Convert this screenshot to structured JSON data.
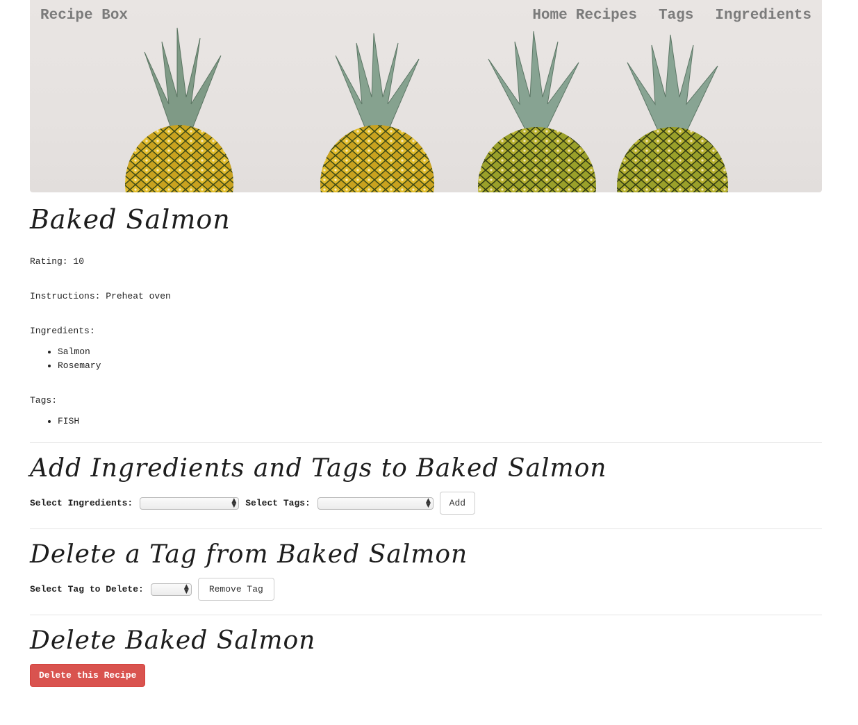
{
  "navbar": {
    "brand": "Recipe Box",
    "links": [
      "Home",
      "Recipes",
      "Tags",
      "Ingredients"
    ]
  },
  "recipe": {
    "title": "Baked Salmon",
    "rating_label": "Rating: 10",
    "instructions_label": "Instructions: Preheat oven",
    "ingredients_label": "Ingredients:",
    "ingredients": [
      "Salmon",
      "Rosemary"
    ],
    "tags_label": "Tags:",
    "tags": [
      "FISH"
    ]
  },
  "add_section": {
    "heading": "Add Ingredients and Tags to Baked Salmon",
    "ingredients_label": "Select Ingredients:",
    "tags_label": "Select Tags:",
    "button": "Add"
  },
  "delete_tag_section": {
    "heading": "Delete a Tag from Baked Salmon",
    "label": "Select Tag to Delete:",
    "button": "Remove Tag"
  },
  "delete_recipe_section": {
    "heading": "Delete Baked Salmon",
    "button": "Delete this Recipe"
  },
  "colors": {
    "danger": "#d9534f",
    "nav_text": "#7b7b7b",
    "hero_bg": "#e6e2e0"
  }
}
